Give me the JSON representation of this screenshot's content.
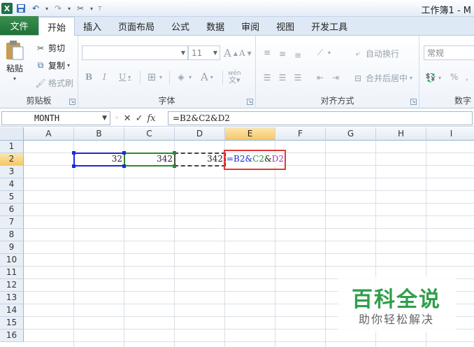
{
  "title_bar": {
    "title": "工作簿1 - M"
  },
  "tabs": {
    "file": "文件",
    "items": [
      "开始",
      "插入",
      "页面布局",
      "公式",
      "数据",
      "审阅",
      "视图",
      "开发工具"
    ]
  },
  "ribbon": {
    "clipboard": {
      "paste": "粘贴",
      "cut": "剪切",
      "copy": "复制",
      "format_painter": "格式刷",
      "label": "剪贴板"
    },
    "font": {
      "font_size": "11",
      "bold": "B",
      "italic": "I",
      "underline": "U",
      "grow": "A",
      "shrink": "A",
      "color_a": "A",
      "wen": "wén",
      "label": "字体"
    },
    "alignment": {
      "wrap": "自动换行",
      "merge": "合并后居中",
      "label": "对齐方式"
    },
    "number": {
      "format": "常规",
      "percent": "%",
      "label": "数字"
    }
  },
  "formula_bar": {
    "name_box": "MONTH",
    "fx": "fx",
    "formula": "=B2&C2&D2"
  },
  "columns": [
    "A",
    "B",
    "C",
    "D",
    "E",
    "F",
    "G",
    "H",
    "I"
  ],
  "rows": [
    "1",
    "2",
    "3",
    "4",
    "5",
    "6",
    "7",
    "8",
    "9",
    "10",
    "11",
    "12",
    "13",
    "14",
    "15",
    "16"
  ],
  "cells": {
    "B2": "32",
    "C2": "342",
    "D2": "342"
  },
  "edit_cell": {
    "p1": "=B2&",
    "p2": "C2",
    "p3": "&",
    "p4": "D2"
  },
  "watermark": {
    "main": "百科全说",
    "sub": "助你轻松解决"
  },
  "colors": {
    "file_tab": "#1f7038",
    "ref_b": "#1a2bd6",
    "ref_c": "#2b8a2b",
    "edit_highlight": "#e03a3a",
    "selected_header": "#f5c766",
    "watermark": "#2f9e4a"
  }
}
